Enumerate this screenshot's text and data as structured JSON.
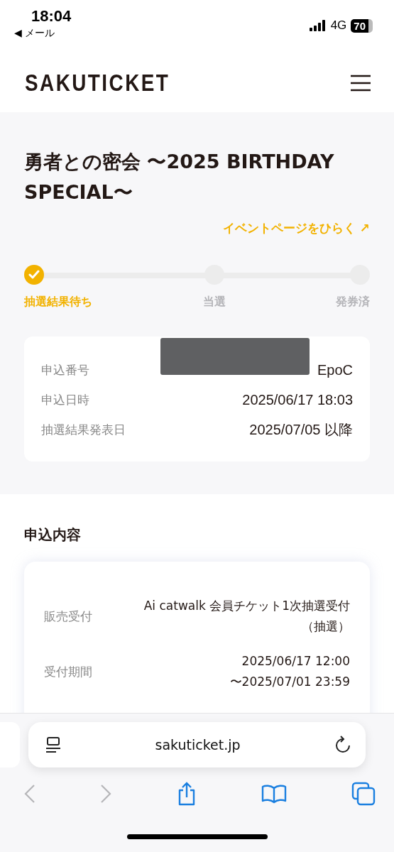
{
  "status_bar": {
    "time": "18:04",
    "back_app": "◀ メール",
    "network": "4G",
    "battery": "70"
  },
  "header": {
    "logo": "SAKUTICKET"
  },
  "event": {
    "title": "勇者との密会 〜2025 BIRTHDAY SPECIAL〜",
    "link": "イベントページをひらく ↗"
  },
  "steps": [
    {
      "label": "抽選結果待ち",
      "done": true
    },
    {
      "label": "当選",
      "done": false
    },
    {
      "label": "発券済",
      "done": false
    }
  ],
  "summary": [
    {
      "label": "申込番号",
      "value": "EpoC",
      "redacted": true
    },
    {
      "label": "申込日時",
      "value": "2025/06/17 18:03",
      "redacted": false
    },
    {
      "label": "抽選結果発表日",
      "value": "2025/07/05 以降",
      "redacted": false
    }
  ],
  "details": {
    "heading": "申込内容",
    "rows": [
      {
        "label": "販売受付",
        "lines": [
          "Ai catwalk 会員チケット1次抽選受付",
          "（抽選）"
        ]
      },
      {
        "label": "受付期間",
        "lines": [
          "2025/06/17 12:00",
          "〜2025/07/01 23:59"
        ]
      }
    ]
  },
  "browser": {
    "url": "sakuticket.jp"
  }
}
